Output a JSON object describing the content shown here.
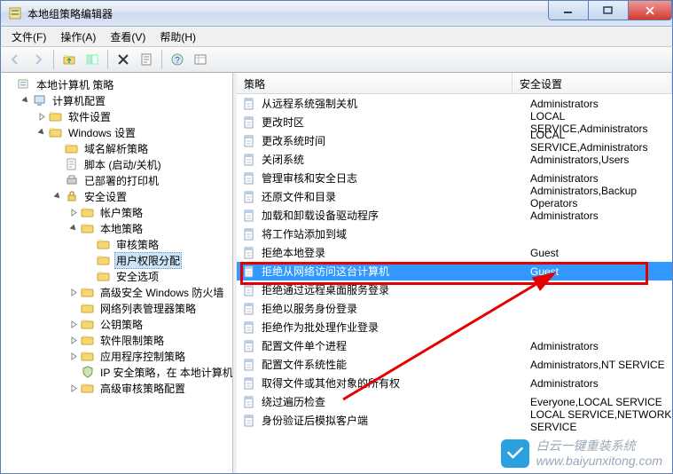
{
  "window": {
    "title": "本地组策略编辑器"
  },
  "menu": {
    "file": "文件(F)",
    "action": "操作(A)",
    "view": "查看(V)",
    "help": "帮助(H)"
  },
  "tree": {
    "root": "本地计算机 策略",
    "computer_config": "计算机配置",
    "software_settings": "软件设置",
    "windows_settings": "Windows 设置",
    "dns_policy": "域名解析策略",
    "scripts": "脚本 (启动/关机)",
    "deployed_printers": "已部署的打印机",
    "security_settings": "安全设置",
    "account_policies": "帐户策略",
    "local_policies": "本地策略",
    "audit_policy": "审核策略",
    "user_rights_assignment": "用户权限分配",
    "security_options": "安全选项",
    "adv_firewall": "高级安全 Windows 防火墙",
    "network_list_mgr": "网络列表管理器策略",
    "public_key": "公钥策略",
    "software_restriction": "软件限制策略",
    "app_control": "应用程序控制策略",
    "ip_security": "IP 安全策略，在 本地计算机",
    "adv_audit": "高级审核策略配置"
  },
  "columns": {
    "policy": "策略",
    "security_setting": "安全设置"
  },
  "policies": [
    {
      "name": "从远程系统强制关机",
      "setting": "Administrators"
    },
    {
      "name": "更改时区",
      "setting": "LOCAL SERVICE,Administrators"
    },
    {
      "name": "更改系统时间",
      "setting": "LOCAL SERVICE,Administrators"
    },
    {
      "name": "关闭系统",
      "setting": "Administrators,Users"
    },
    {
      "name": "管理审核和安全日志",
      "setting": "Administrators"
    },
    {
      "name": "还原文件和目录",
      "setting": "Administrators,Backup Operators"
    },
    {
      "name": "加载和卸载设备驱动程序",
      "setting": "Administrators"
    },
    {
      "name": "将工作站添加到域",
      "setting": ""
    },
    {
      "name": "拒绝本地登录",
      "setting": "Guest"
    },
    {
      "name": "拒绝从网络访问这台计算机",
      "setting": "Guest",
      "selected": true
    },
    {
      "name": "拒绝通过远程桌面服务登录",
      "setting": ""
    },
    {
      "name": "拒绝以服务身份登录",
      "setting": ""
    },
    {
      "name": "拒绝作为批处理作业登录",
      "setting": ""
    },
    {
      "name": "配置文件单个进程",
      "setting": "Administrators"
    },
    {
      "name": "配置文件系统性能",
      "setting": "Administrators,NT SERVICE"
    },
    {
      "name": "取得文件或其他对象的所有权",
      "setting": "Administrators"
    },
    {
      "name": "绕过遍历检查",
      "setting": "Everyone,LOCAL SERVICE"
    },
    {
      "name": "身份验证后模拟客户端",
      "setting": "LOCAL SERVICE,NETWORK SERVICE"
    }
  ],
  "watermark": {
    "line1": "白云一键重装系统",
    "line2": "www.baiyunxitong.com"
  }
}
